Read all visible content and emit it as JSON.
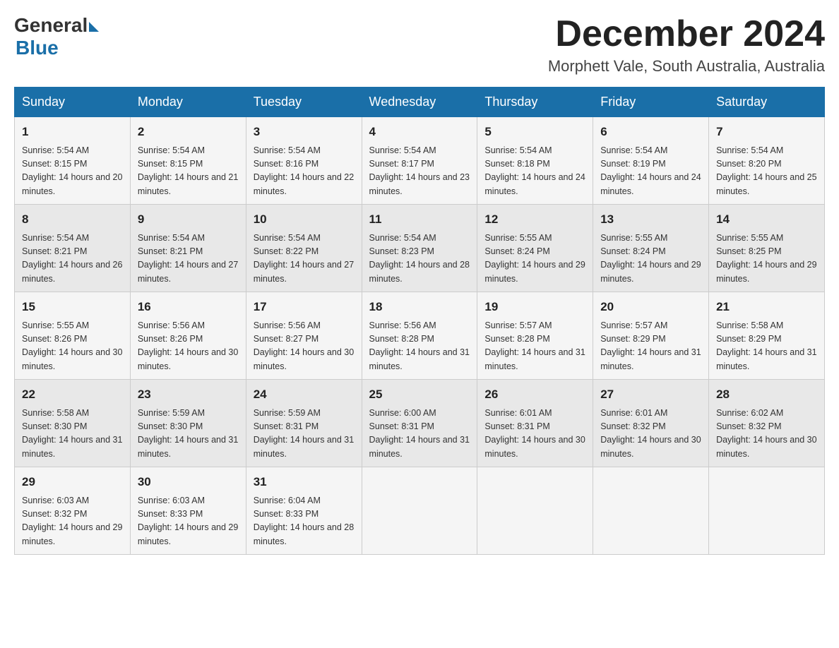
{
  "header": {
    "logo_general": "General",
    "logo_blue": "Blue",
    "month_title": "December 2024",
    "location": "Morphett Vale, South Australia, Australia"
  },
  "weekdays": [
    "Sunday",
    "Monday",
    "Tuesday",
    "Wednesday",
    "Thursday",
    "Friday",
    "Saturday"
  ],
  "weeks": [
    [
      {
        "day": "1",
        "sunrise": "5:54 AM",
        "sunset": "8:15 PM",
        "daylight": "14 hours and 20 minutes."
      },
      {
        "day": "2",
        "sunrise": "5:54 AM",
        "sunset": "8:15 PM",
        "daylight": "14 hours and 21 minutes."
      },
      {
        "day": "3",
        "sunrise": "5:54 AM",
        "sunset": "8:16 PM",
        "daylight": "14 hours and 22 minutes."
      },
      {
        "day": "4",
        "sunrise": "5:54 AM",
        "sunset": "8:17 PM",
        "daylight": "14 hours and 23 minutes."
      },
      {
        "day": "5",
        "sunrise": "5:54 AM",
        "sunset": "8:18 PM",
        "daylight": "14 hours and 24 minutes."
      },
      {
        "day": "6",
        "sunrise": "5:54 AM",
        "sunset": "8:19 PM",
        "daylight": "14 hours and 24 minutes."
      },
      {
        "day": "7",
        "sunrise": "5:54 AM",
        "sunset": "8:20 PM",
        "daylight": "14 hours and 25 minutes."
      }
    ],
    [
      {
        "day": "8",
        "sunrise": "5:54 AM",
        "sunset": "8:21 PM",
        "daylight": "14 hours and 26 minutes."
      },
      {
        "day": "9",
        "sunrise": "5:54 AM",
        "sunset": "8:21 PM",
        "daylight": "14 hours and 27 minutes."
      },
      {
        "day": "10",
        "sunrise": "5:54 AM",
        "sunset": "8:22 PM",
        "daylight": "14 hours and 27 minutes."
      },
      {
        "day": "11",
        "sunrise": "5:54 AM",
        "sunset": "8:23 PM",
        "daylight": "14 hours and 28 minutes."
      },
      {
        "day": "12",
        "sunrise": "5:55 AM",
        "sunset": "8:24 PM",
        "daylight": "14 hours and 29 minutes."
      },
      {
        "day": "13",
        "sunrise": "5:55 AM",
        "sunset": "8:24 PM",
        "daylight": "14 hours and 29 minutes."
      },
      {
        "day": "14",
        "sunrise": "5:55 AM",
        "sunset": "8:25 PM",
        "daylight": "14 hours and 29 minutes."
      }
    ],
    [
      {
        "day": "15",
        "sunrise": "5:55 AM",
        "sunset": "8:26 PM",
        "daylight": "14 hours and 30 minutes."
      },
      {
        "day": "16",
        "sunrise": "5:56 AM",
        "sunset": "8:26 PM",
        "daylight": "14 hours and 30 minutes."
      },
      {
        "day": "17",
        "sunrise": "5:56 AM",
        "sunset": "8:27 PM",
        "daylight": "14 hours and 30 minutes."
      },
      {
        "day": "18",
        "sunrise": "5:56 AM",
        "sunset": "8:28 PM",
        "daylight": "14 hours and 31 minutes."
      },
      {
        "day": "19",
        "sunrise": "5:57 AM",
        "sunset": "8:28 PM",
        "daylight": "14 hours and 31 minutes."
      },
      {
        "day": "20",
        "sunrise": "5:57 AM",
        "sunset": "8:29 PM",
        "daylight": "14 hours and 31 minutes."
      },
      {
        "day": "21",
        "sunrise": "5:58 AM",
        "sunset": "8:29 PM",
        "daylight": "14 hours and 31 minutes."
      }
    ],
    [
      {
        "day": "22",
        "sunrise": "5:58 AM",
        "sunset": "8:30 PM",
        "daylight": "14 hours and 31 minutes."
      },
      {
        "day": "23",
        "sunrise": "5:59 AM",
        "sunset": "8:30 PM",
        "daylight": "14 hours and 31 minutes."
      },
      {
        "day": "24",
        "sunrise": "5:59 AM",
        "sunset": "8:31 PM",
        "daylight": "14 hours and 31 minutes."
      },
      {
        "day": "25",
        "sunrise": "6:00 AM",
        "sunset": "8:31 PM",
        "daylight": "14 hours and 31 minutes."
      },
      {
        "day": "26",
        "sunrise": "6:01 AM",
        "sunset": "8:31 PM",
        "daylight": "14 hours and 30 minutes."
      },
      {
        "day": "27",
        "sunrise": "6:01 AM",
        "sunset": "8:32 PM",
        "daylight": "14 hours and 30 minutes."
      },
      {
        "day": "28",
        "sunrise": "6:02 AM",
        "sunset": "8:32 PM",
        "daylight": "14 hours and 30 minutes."
      }
    ],
    [
      {
        "day": "29",
        "sunrise": "6:03 AM",
        "sunset": "8:32 PM",
        "daylight": "14 hours and 29 minutes."
      },
      {
        "day": "30",
        "sunrise": "6:03 AM",
        "sunset": "8:33 PM",
        "daylight": "14 hours and 29 minutes."
      },
      {
        "day": "31",
        "sunrise": "6:04 AM",
        "sunset": "8:33 PM",
        "daylight": "14 hours and 28 minutes."
      },
      null,
      null,
      null,
      null
    ]
  ],
  "labels": {
    "sunrise": "Sunrise: ",
    "sunset": "Sunset: ",
    "daylight": "Daylight: "
  }
}
